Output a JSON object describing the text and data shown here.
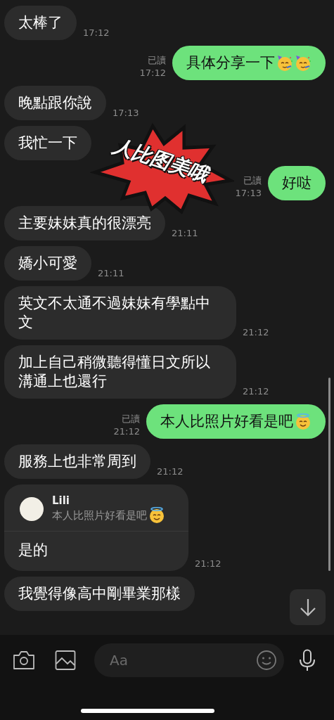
{
  "messages": [
    {
      "kind": "in",
      "text": "太棒了",
      "time": "17:12"
    },
    {
      "kind": "out",
      "text": "具体分享一下",
      "emojis": [
        {
          "kind": "party"
        },
        {
          "kind": "party"
        }
      ],
      "read": "已讀",
      "time": "17:12"
    },
    {
      "kind": "in",
      "text": "晚點跟你說",
      "time": "17:13"
    },
    {
      "kind": "in",
      "text": "我忙一下"
    },
    {
      "kind": "out",
      "text": "好哒",
      "read": "已讀",
      "time": "17:13"
    },
    {
      "kind": "in",
      "text": "主要妹妹真的很漂亮",
      "time": "21:11"
    },
    {
      "kind": "in",
      "text": "嬌小可愛",
      "time": "21:11"
    },
    {
      "kind": "in",
      "text": "英文不太通不過妹妹有學點中文",
      "time": "21:12"
    },
    {
      "kind": "in",
      "text": "加上自己稍微聽得懂日文所以溝通上也還行",
      "time": "21:12"
    },
    {
      "kind": "out",
      "text": "本人比照片好看是吧",
      "emojis": [
        {
          "kind": "halo"
        }
      ],
      "read": "已讀",
      "time": "21:12"
    },
    {
      "kind": "in",
      "text": "服務上也非常周到",
      "time": "21:12"
    },
    {
      "kind": "reply",
      "quote_name": "Lili",
      "quote_text": "本人比照片好看是吧",
      "quote_emojis": [
        {
          "kind": "halo"
        }
      ],
      "text": "是的",
      "time": "21:12"
    },
    {
      "kind": "in",
      "text": "我覺得像高中剛畢業那樣"
    }
  ],
  "sticker": {
    "text": "人比图美哦"
  },
  "input": {
    "placeholder": "Aa"
  }
}
